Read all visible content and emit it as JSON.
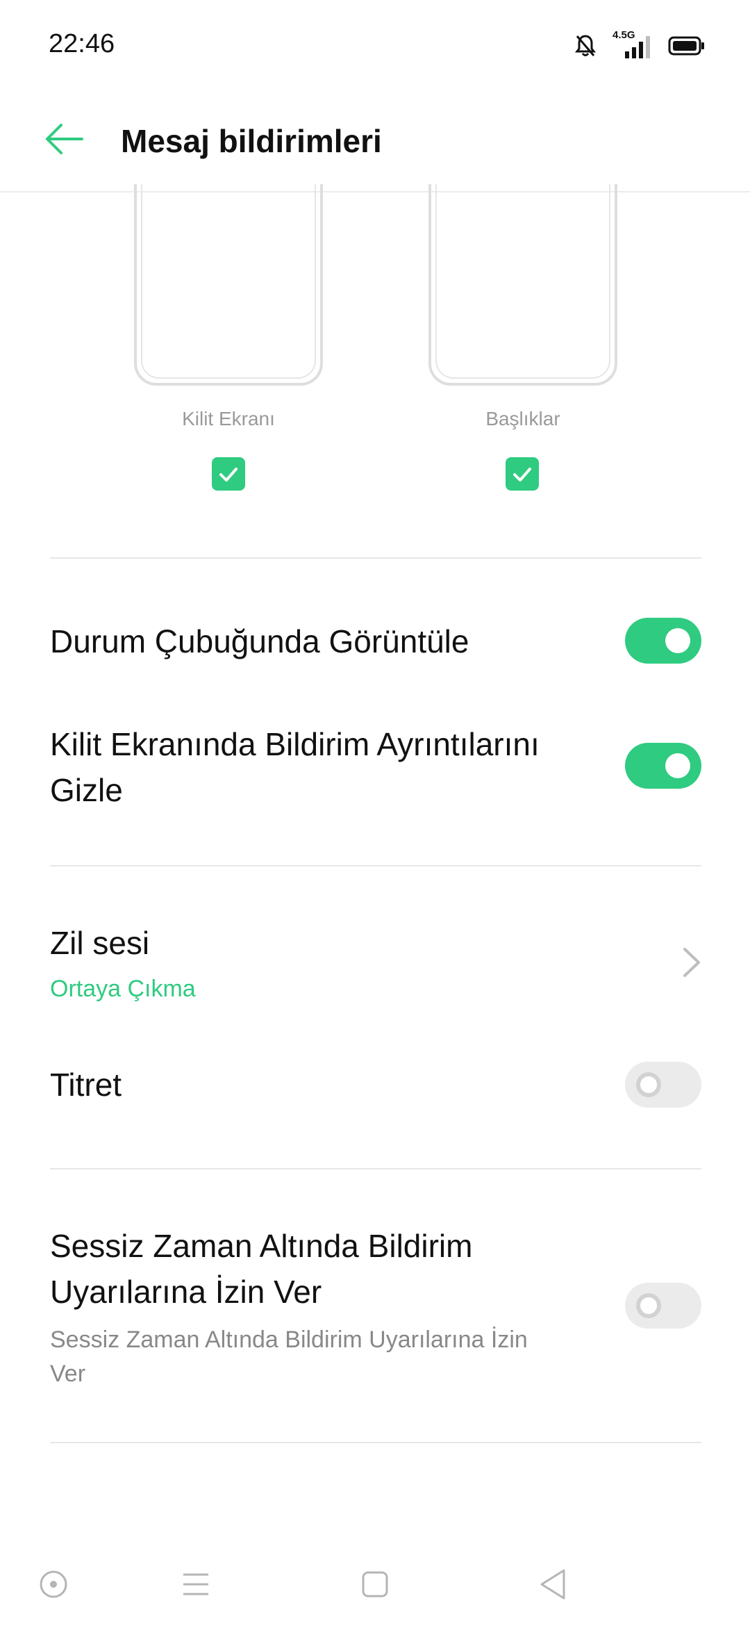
{
  "status_bar": {
    "time": "22:46",
    "network_label": "4.5G",
    "icons": [
      "bell-off-icon",
      "signal-icon",
      "battery-icon"
    ]
  },
  "header": {
    "title": "Mesaj bildirimleri",
    "back_icon": "arrow-left-icon"
  },
  "previews": [
    {
      "label": "Kilit Ekranı",
      "checked": true
    },
    {
      "label": "Başlıklar",
      "checked": true
    }
  ],
  "settings": {
    "status_bar_display": {
      "title": "Durum Çubuğunda Görüntüle",
      "enabled": true
    },
    "hide_details": {
      "title_line1": "Kilit Ekranında Bildirim Ayrıntılarını",
      "title_line2": "Gizle",
      "enabled": true
    },
    "ringtone": {
      "title": "Zil sesi",
      "value": "Ortaya Çıkma"
    },
    "vibrate": {
      "title": "Titret",
      "enabled": false
    },
    "quiet_time": {
      "title_line1": "Sessiz Zaman Altında Bildirim",
      "title_line2": "Uyarılarına İzin Ver",
      "sub_line1": "Sessiz Zaman Altında Bildirim Uyarılarına İzin",
      "sub_line2": "Ver",
      "enabled": false
    }
  },
  "nav": {
    "icons": [
      "assistant-icon",
      "menu-icon",
      "home-square-icon",
      "back-triangle-icon"
    ]
  },
  "colors": {
    "accent": "#2fcb80",
    "toggle_off": "#ebebeb",
    "divider": "#e6e6e6"
  }
}
